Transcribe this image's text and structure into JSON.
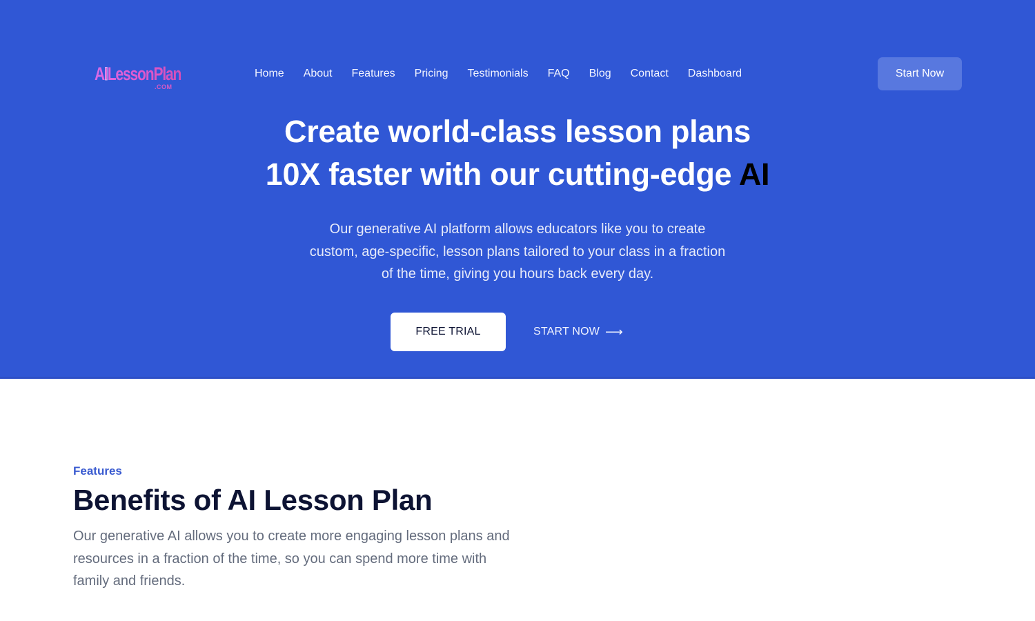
{
  "colors": {
    "hero_bg": "#3057D5",
    "accent": "#3a5bd0",
    "header_cta_bg": "#5878df",
    "heading_dark": "#0d1333",
    "body_gray": "#646c7d",
    "logo_gradient": [
      "#d86be8",
      "#d34fb8"
    ]
  },
  "header": {
    "logo": {
      "text_prefix": "A",
      "text_i": "I",
      "text_rest": "LessonPlan",
      "suffix": ".COM"
    },
    "nav": [
      {
        "label": "Home"
      },
      {
        "label": "About"
      },
      {
        "label": "Features"
      },
      {
        "label": "Pricing"
      },
      {
        "label": "Testimonials"
      },
      {
        "label": "FAQ"
      },
      {
        "label": "Blog"
      },
      {
        "label": "Contact"
      },
      {
        "label": "Dashboard"
      }
    ],
    "cta_label": "Start Now"
  },
  "hero": {
    "title_line1": "Create world-class lesson plans",
    "title_line2": "10X faster with our cutting-edge ",
    "title_accent": "AI",
    "subtitle": "Our generative AI platform allows educators like you to create custom, age-specific, lesson plans tailored to your class in a fraction of the time, giving you hours back every day.",
    "primary_button": "FREE TRIAL",
    "secondary_button": "START NOW",
    "secondary_icon": "⟶"
  },
  "features": {
    "eyebrow": "Features",
    "title": "Benefits of AI Lesson Plan",
    "description": "Our generative AI allows you to create more engaging lesson plans and resources in a fraction of the time, so you can spend more time with family and friends."
  }
}
